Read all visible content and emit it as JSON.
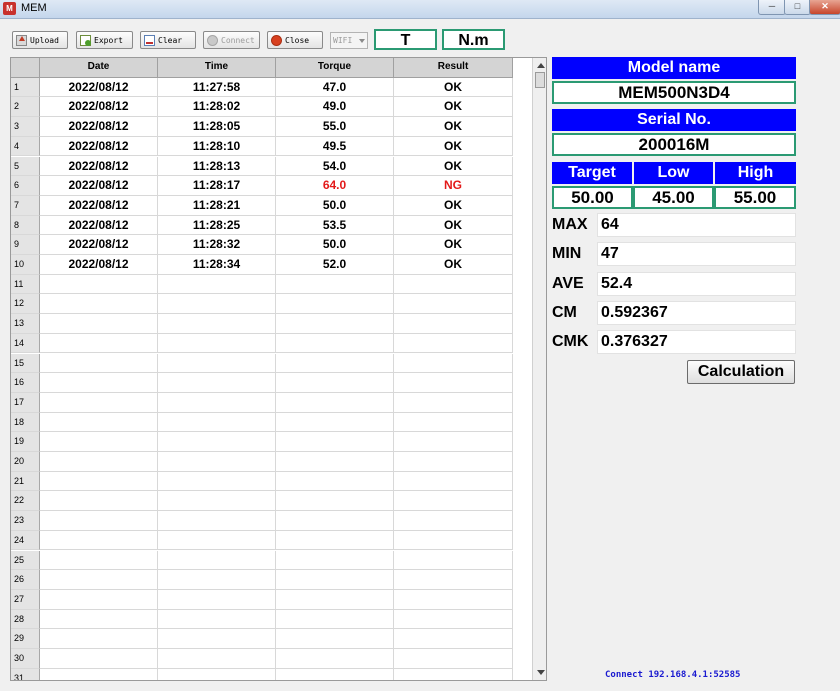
{
  "window": {
    "title": "MEM",
    "icon_label": "M"
  },
  "toolbar": {
    "upload": "Upload",
    "export": "Export",
    "clear": "Clear",
    "connect": "Connect",
    "close": "Close",
    "connection_type": "WIFI",
    "unit_torque": "T",
    "unit_measure": "N.m"
  },
  "table": {
    "columns": [
      "Date",
      "Time",
      "Torque",
      "Result"
    ],
    "rows": [
      {
        "n": "1",
        "date": "2022/08/12",
        "time": "11:27:58",
        "torque": "47.0",
        "result": "OK"
      },
      {
        "n": "2",
        "date": "2022/08/12",
        "time": "11:28:02",
        "torque": "49.0",
        "result": "OK"
      },
      {
        "n": "3",
        "date": "2022/08/12",
        "time": "11:28:05",
        "torque": "55.0",
        "result": "OK"
      },
      {
        "n": "4",
        "date": "2022/08/12",
        "time": "11:28:10",
        "torque": "49.5",
        "result": "OK"
      },
      {
        "n": "5",
        "date": "2022/08/12",
        "time": "11:28:13",
        "torque": "54.0",
        "result": "OK"
      },
      {
        "n": "6",
        "date": "2022/08/12",
        "time": "11:28:17",
        "torque": "64.0",
        "result": "NG"
      },
      {
        "n": "7",
        "date": "2022/08/12",
        "time": "11:28:21",
        "torque": "50.0",
        "result": "OK"
      },
      {
        "n": "8",
        "date": "2022/08/12",
        "time": "11:28:25",
        "torque": "53.5",
        "result": "OK"
      },
      {
        "n": "9",
        "date": "2022/08/12",
        "time": "11:28:32",
        "torque": "50.0",
        "result": "OK"
      },
      {
        "n": "10",
        "date": "2022/08/12",
        "time": "11:28:34",
        "torque": "52.0",
        "result": "OK"
      },
      {
        "n": "11",
        "date": "",
        "time": "",
        "torque": "",
        "result": ""
      },
      {
        "n": "12",
        "date": "",
        "time": "",
        "torque": "",
        "result": ""
      },
      {
        "n": "13",
        "date": "",
        "time": "",
        "torque": "",
        "result": ""
      },
      {
        "n": "14",
        "date": "",
        "time": "",
        "torque": "",
        "result": ""
      },
      {
        "n": "15",
        "date": "",
        "time": "",
        "torque": "",
        "result": ""
      },
      {
        "n": "16",
        "date": "",
        "time": "",
        "torque": "",
        "result": ""
      },
      {
        "n": "17",
        "date": "",
        "time": "",
        "torque": "",
        "result": ""
      },
      {
        "n": "18",
        "date": "",
        "time": "",
        "torque": "",
        "result": ""
      },
      {
        "n": "19",
        "date": "",
        "time": "",
        "torque": "",
        "result": ""
      },
      {
        "n": "20",
        "date": "",
        "time": "",
        "torque": "",
        "result": ""
      },
      {
        "n": "21",
        "date": "",
        "time": "",
        "torque": "",
        "result": ""
      },
      {
        "n": "22",
        "date": "",
        "time": "",
        "torque": "",
        "result": ""
      },
      {
        "n": "23",
        "date": "",
        "time": "",
        "torque": "",
        "result": ""
      },
      {
        "n": "24",
        "date": "",
        "time": "",
        "torque": "",
        "result": ""
      },
      {
        "n": "25",
        "date": "",
        "time": "",
        "torque": "",
        "result": ""
      },
      {
        "n": "26",
        "date": "",
        "time": "",
        "torque": "",
        "result": ""
      },
      {
        "n": "27",
        "date": "",
        "time": "",
        "torque": "",
        "result": ""
      },
      {
        "n": "28",
        "date": "",
        "time": "",
        "torque": "",
        "result": ""
      },
      {
        "n": "29",
        "date": "",
        "time": "",
        "torque": "",
        "result": ""
      },
      {
        "n": "30",
        "date": "",
        "time": "",
        "torque": "",
        "result": ""
      },
      {
        "n": "31",
        "date": "",
        "time": "",
        "torque": "",
        "result": ""
      }
    ]
  },
  "panel": {
    "model_label": "Model name",
    "model_value": "MEM500N3D4",
    "serial_label": "Serial No.",
    "serial_value": "200016M",
    "target_label": "Target",
    "low_label": "Low",
    "high_label": "High",
    "target_value": "50.00",
    "low_value": "45.00",
    "high_value": "55.00",
    "stats": [
      {
        "label": "MAX",
        "value": "64"
      },
      {
        "label": "MIN",
        "value": "47"
      },
      {
        "label": "AVE",
        "value": "52.4"
      },
      {
        "label": "CM",
        "value": "0.592367"
      },
      {
        "label": "CMK",
        "value": "0.376327"
      }
    ],
    "calc_button": "Calculation"
  },
  "status": {
    "connection": "Connect 192.168.4.1:52585"
  },
  "colors": {
    "header_blue": "#0000ff",
    "box_border": "#2b9a73",
    "ng_red": "#e31a1a",
    "status_blue": "#1a1ad0"
  }
}
